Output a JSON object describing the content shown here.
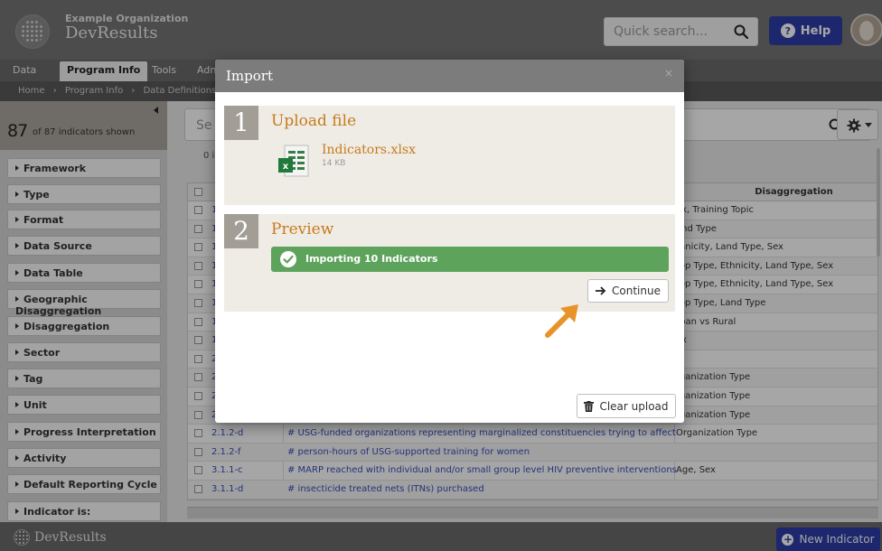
{
  "header": {
    "org_name": "Example Organization",
    "app_name": "DevResults",
    "search_placeholder": "Quick search...",
    "help_label": "Help"
  },
  "nav": {
    "tabs": [
      {
        "label": "Data"
      },
      {
        "label": "Program Info"
      },
      {
        "label": "Tools"
      },
      {
        "label": "Adn"
      }
    ]
  },
  "breadcrumb": [
    "Home",
    "Program Info",
    "Data Definitions"
  ],
  "sidebar": {
    "count": "87",
    "count_label": "of 87 indicators shown",
    "filters": [
      "Framework",
      "Type",
      "Format",
      "Data Source",
      "Data Table",
      "Geographic Disaggregation",
      "Disaggregation",
      "Sector",
      "Tag",
      "Unit",
      "Progress Interpretation",
      "Activity",
      "Default Reporting Cycle",
      "Indicator is:"
    ]
  },
  "main": {
    "search_placeholder": "Se",
    "selected_count": "0 i",
    "disaggregation_header": "Disaggregation",
    "rows": [
      {
        "code": "1",
        "name": "",
        "disagg": "ex, Training Topic"
      },
      {
        "code": "1",
        "name": "",
        "disagg": "and Type"
      },
      {
        "code": "1",
        "name": "",
        "disagg": "thnicity, Land Type, Sex"
      },
      {
        "code": "1",
        "name": "",
        "disagg": "rop Type, Ethnicity, Land Type, Sex"
      },
      {
        "code": "1",
        "name": "",
        "disagg": "rop Type, Ethnicity, Land Type, Sex"
      },
      {
        "code": "1",
        "name": "",
        "disagg": "rop Type, Land Type"
      },
      {
        "code": "1",
        "name": "",
        "disagg": "rban vs Rural"
      },
      {
        "code": "1",
        "name": "",
        "disagg": "ex"
      },
      {
        "code": "2",
        "name": "",
        "disagg": ""
      },
      {
        "code": "2",
        "name": "",
        "disagg": "rganization Type"
      },
      {
        "code": "2",
        "name": "",
        "disagg": "rganization Type"
      },
      {
        "code": "2",
        "name": "",
        "disagg": "rganization Type"
      },
      {
        "code": "2.1.2-d",
        "name": "# USG-funded organizations representing marginalized constituencies trying to affect governmen",
        "disagg": "Organization Type"
      },
      {
        "code": "2.1.2-f",
        "name": "# person-hours of USG-supported training for women",
        "disagg": ""
      },
      {
        "code": "3.1.1-c",
        "name": "# MARP reached with individual and/or small group level HIV preventive interventions that are ba",
        "disagg": "Age, Sex"
      },
      {
        "code": "3.1.1-d",
        "name": "# insecticide treated nets (ITNs) purchased",
        "disagg": ""
      }
    ]
  },
  "footer": {
    "app_name": "DevResults",
    "new_indicator_label": "New Indicator"
  },
  "modal": {
    "title": "Import",
    "close": "×",
    "step1": {
      "number": "1",
      "title": "Upload file",
      "file_name": "Indicators.xlsx",
      "file_size": "14 KB"
    },
    "step2": {
      "number": "2",
      "title": "Preview",
      "progress_text": "Importing 10 Indicators",
      "continue_label": "Continue"
    },
    "clear_label": "Clear upload"
  },
  "colors": {
    "accent": "#2d3da8",
    "orange": "#c77a1b",
    "success": "#5ea35b"
  }
}
